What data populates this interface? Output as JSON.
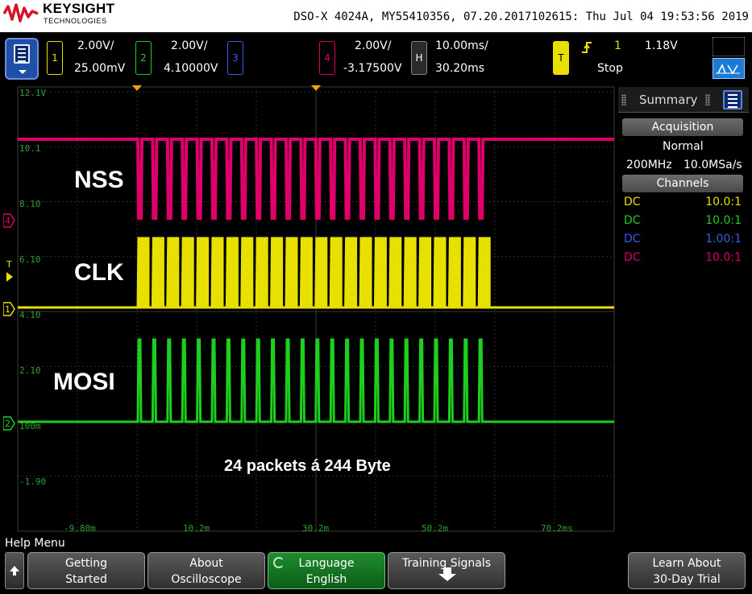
{
  "brand": {
    "name": "KEYSIGHT",
    "sub": "TECHNOLOGIES"
  },
  "instrument_info": "DSO-X 4024A, MY55410356, 07.20.2017102615: Thu Jul 04 19:53:56 2019",
  "channels": [
    {
      "num": "1",
      "scale": "2.00V/",
      "offset": "25.00mV",
      "color": "#e8e000"
    },
    {
      "num": "2",
      "scale": "2.00V/",
      "offset": "4.10000V",
      "color": "#1ecf1e"
    },
    {
      "num": "3",
      "scale": "",
      "offset": "",
      "color": "#3a5ae8"
    },
    {
      "num": "4",
      "scale": "2.00V/",
      "offset": "-3.17500V",
      "color": "#e0006a"
    }
  ],
  "horizontal": {
    "label": "H",
    "timebase": "10.00ms/",
    "delay": "30.20ms"
  },
  "trigger": {
    "label": "T",
    "edge_icon": "rising-edge-icon",
    "source": "1",
    "level": "1.18V",
    "status": "Stop"
  },
  "graticule": {
    "y_labels": [
      "12.1V",
      "10.1",
      "8.10",
      "6.10",
      "4.10",
      "2.10",
      "100m",
      "-1.90"
    ],
    "x_labels": [
      "-9.80m",
      "10.2m",
      "30.2m",
      "50.2m",
      "70.2ms"
    ]
  },
  "overlay": {
    "nss": "NSS",
    "clk": "CLK",
    "mosi": "MOSI",
    "note": "24 packets á 244 Byte"
  },
  "markers": {
    "ch4": "4",
    "trigger_level": "T",
    "ch1": "1",
    "ch2": "2"
  },
  "side_panel": {
    "title": "Summary",
    "acquisition_header": "Acquisition",
    "mode": "Normal",
    "bandwidth": "200MHz",
    "sample_rate": "10.0MSa/s",
    "channels_header": "Channels",
    "probes": [
      {
        "coupling": "DC",
        "ratio": "10.0:1",
        "color": "#e8e000"
      },
      {
        "coupling": "DC",
        "ratio": "10.0:1",
        "color": "#1ecf1e"
      },
      {
        "coupling": "DC",
        "ratio": "1.00:1",
        "color": "#3a5ae8"
      },
      {
        "coupling": "DC",
        "ratio": "10.0:1",
        "color": "#e0006a"
      }
    ]
  },
  "softkeys": {
    "menu_title": "Help Menu",
    "getting_started": [
      "Getting",
      "Started"
    ],
    "about": [
      "About",
      "Oscilloscope"
    ],
    "language": [
      "Language",
      "English"
    ],
    "training": "Training Signals",
    "trial": [
      "Learn About",
      "30-Day Trial"
    ]
  },
  "colors": {
    "ch1": "#e8e000",
    "ch2": "#1ecf1e",
    "ch3": "#3a5ae8",
    "ch4": "#e0006a",
    "grid": "#2e2e2e",
    "label_green": "#2fa02f"
  }
}
